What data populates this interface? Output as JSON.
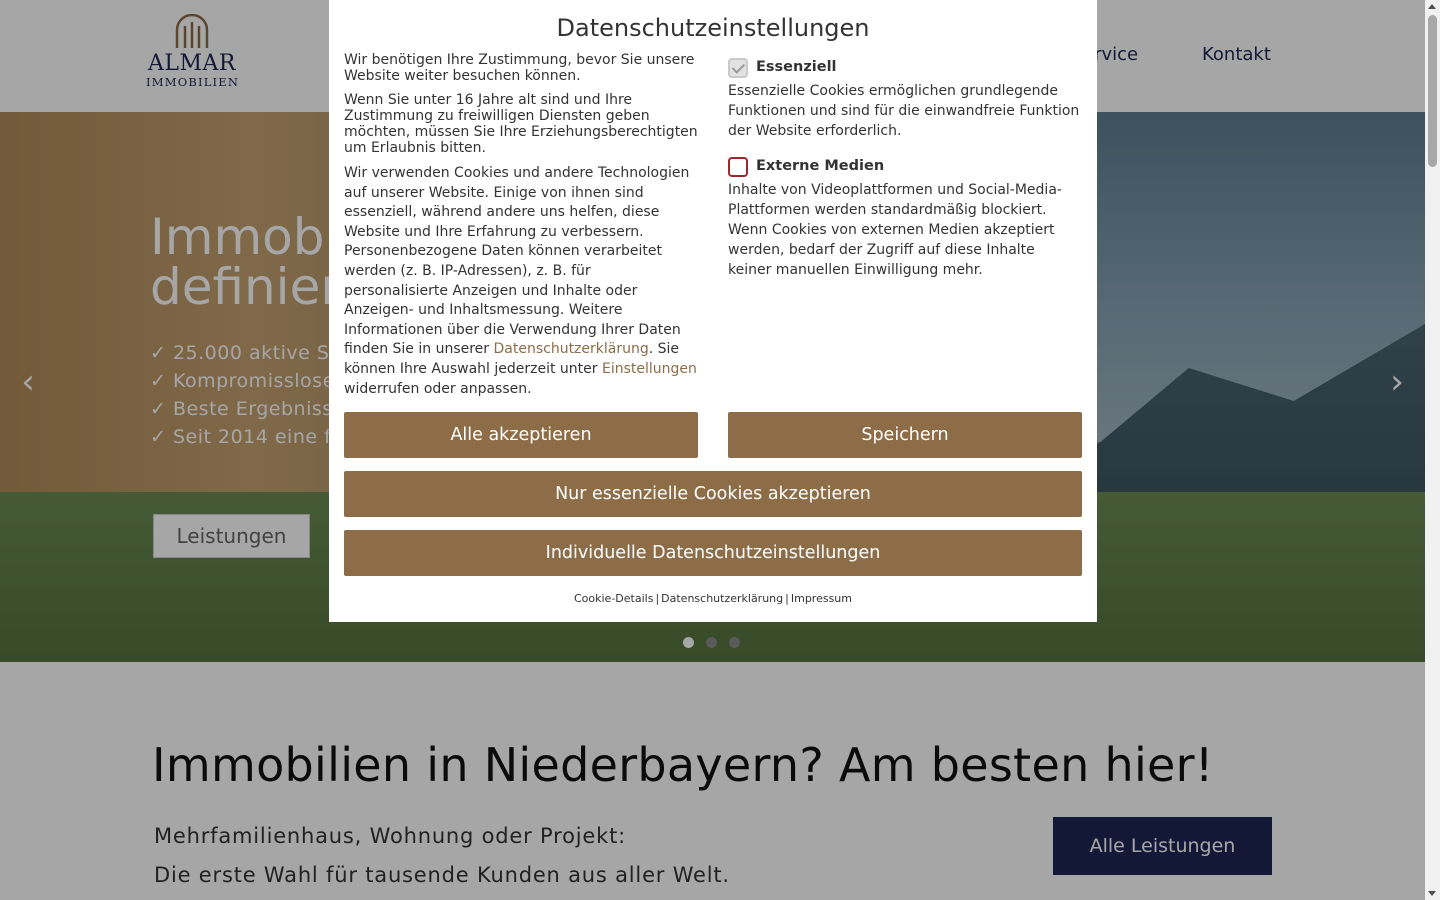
{
  "logo": {
    "name": "ALMAR",
    "sub": "IMMOBILIEN"
  },
  "nav": {
    "items": [
      "ervice",
      "Kontakt"
    ]
  },
  "hero": {
    "title": "Immob\ndefinier",
    "bullets": [
      "✓ 25.000 aktive S",
      "✓ Kompromisslose",
      "✓ Beste Ergebniss",
      "✓ Seit 2014 eine f"
    ],
    "button": "Leistungen",
    "prev_arrow": "‹",
    "next_arrow": "›"
  },
  "main": {
    "heading": "Immobilien in Niederbayern? Am besten hier!",
    "sub1": "Mehrfamilienhaus, Wohnung oder Projekt:",
    "sub2": "Die erste Wahl für tausende Kunden aus aller Welt.",
    "button": "Alle Leistungen"
  },
  "modal": {
    "title": "Datenschutzeinstellungen",
    "p1": "Wir benötigen Ihre Zustimmung, bevor Sie unsere Website weiter besuchen können.",
    "p2": "Wenn Sie unter 16 Jahre alt sind und Ihre Zustimmung zu freiwilligen Diensten geben möchten, müssen Sie Ihre Erziehungsberechtigten um Erlaubnis bitten.",
    "p3_a": "Wir verwenden Cookies und andere Technologien auf unserer Website. Einige von ihnen sind essenziell, während andere uns helfen, diese Website und Ihre Erfahrung zu verbessern. Personenbezogene Daten können verarbeitet werden (z. B. IP-Adressen), z. B. für personalisierte Anzeigen und Inhalte oder Anzeigen- und Inhaltsmessung. Weitere Informationen über die Verwendung Ihrer Daten finden Sie in unserer ",
    "p3_link1": "Datenschutzerklärung",
    "p3_b": ". Sie können Ihre Auswahl jederzeit unter ",
    "p3_link2": "Einstellungen",
    "p3_c": " widerrufen oder anpassen.",
    "essential_label": "Essenziell",
    "essential_desc": "Essenzielle Cookies ermöglichen grundlegende Funktionen und sind für die einwandfreie Funktion der Website erforderlich.",
    "external_label": "Externe Medien",
    "external_desc": "Inhalte von Videoplattformen und Social-Media-Plattformen werden standardmäßig blockiert. Wenn Cookies von externen Medien akzeptiert werden, bedarf der Zugriff auf diese Inhalte keiner manuellen Einwilligung mehr.",
    "btn_accept_all": "Alle akzeptieren",
    "btn_save": "Speichern",
    "btn_essential": "Nur essenzielle Cookies akzeptieren",
    "btn_individual": "Individuelle Datenschutzeinstellungen",
    "footer": {
      "cookie_details": "Cookie-Details",
      "privacy": "Datenschutzerklärung",
      "imprint": "Impressum",
      "separator": "|"
    }
  },
  "colors": {
    "brand_navy": "#1c2552",
    "button_brown": "#8c6d47"
  },
  "carousel": {
    "dot_count": 3,
    "active_index": 0
  }
}
